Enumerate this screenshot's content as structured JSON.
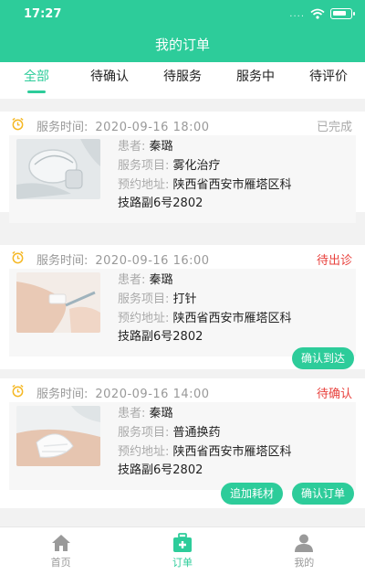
{
  "status_bar": {
    "time": "17:27",
    "signal_dots": "....",
    "icons": [
      "wifi-icon",
      "battery-icon"
    ]
  },
  "nav": {
    "title": "我的订单"
  },
  "tabs": [
    {
      "label": "全部",
      "active": true
    },
    {
      "label": "待确认",
      "active": false
    },
    {
      "label": "待服务",
      "active": false
    },
    {
      "label": "服务中",
      "active": false
    },
    {
      "label": "待评价",
      "active": false
    }
  ],
  "labels": {
    "service_time": "服务时间:",
    "patient": "患者:",
    "service_item": "服务项目:",
    "address": "预约地址:"
  },
  "orders": [
    {
      "time": "2020-09-16 18:00",
      "status": "已完成",
      "patient": "秦璐",
      "item": "雾化治疗",
      "address_line1": "陕西省西安市雁塔区科",
      "address_line2": "技路副6号2802",
      "buttons": []
    },
    {
      "time": "2020-09-16 16:00",
      "status": "待出诊",
      "patient": "秦璐",
      "item": "打针",
      "address_line1": "陕西省西安市雁塔区科",
      "address_line2": "技路副6号2802",
      "buttons": [
        "确认到达"
      ]
    },
    {
      "time": "2020-09-16 14:00",
      "status": "待确认",
      "patient": "秦璐",
      "item": "普通换药",
      "address_line1": "陕西省西安市雁塔区科",
      "address_line2": "技路副6号2802",
      "buttons": [
        "追加耗材",
        "确认订单"
      ]
    }
  ],
  "bottom_nav": [
    {
      "label": "首页",
      "icon": "home-icon",
      "active": false
    },
    {
      "label": "订单",
      "icon": "medical-kit-icon",
      "active": true
    },
    {
      "label": "我的",
      "icon": "user-icon",
      "active": false
    }
  ],
  "colors": {
    "brand": "#2dcc9a",
    "alert": "#e8403c",
    "muted": "#999999"
  }
}
